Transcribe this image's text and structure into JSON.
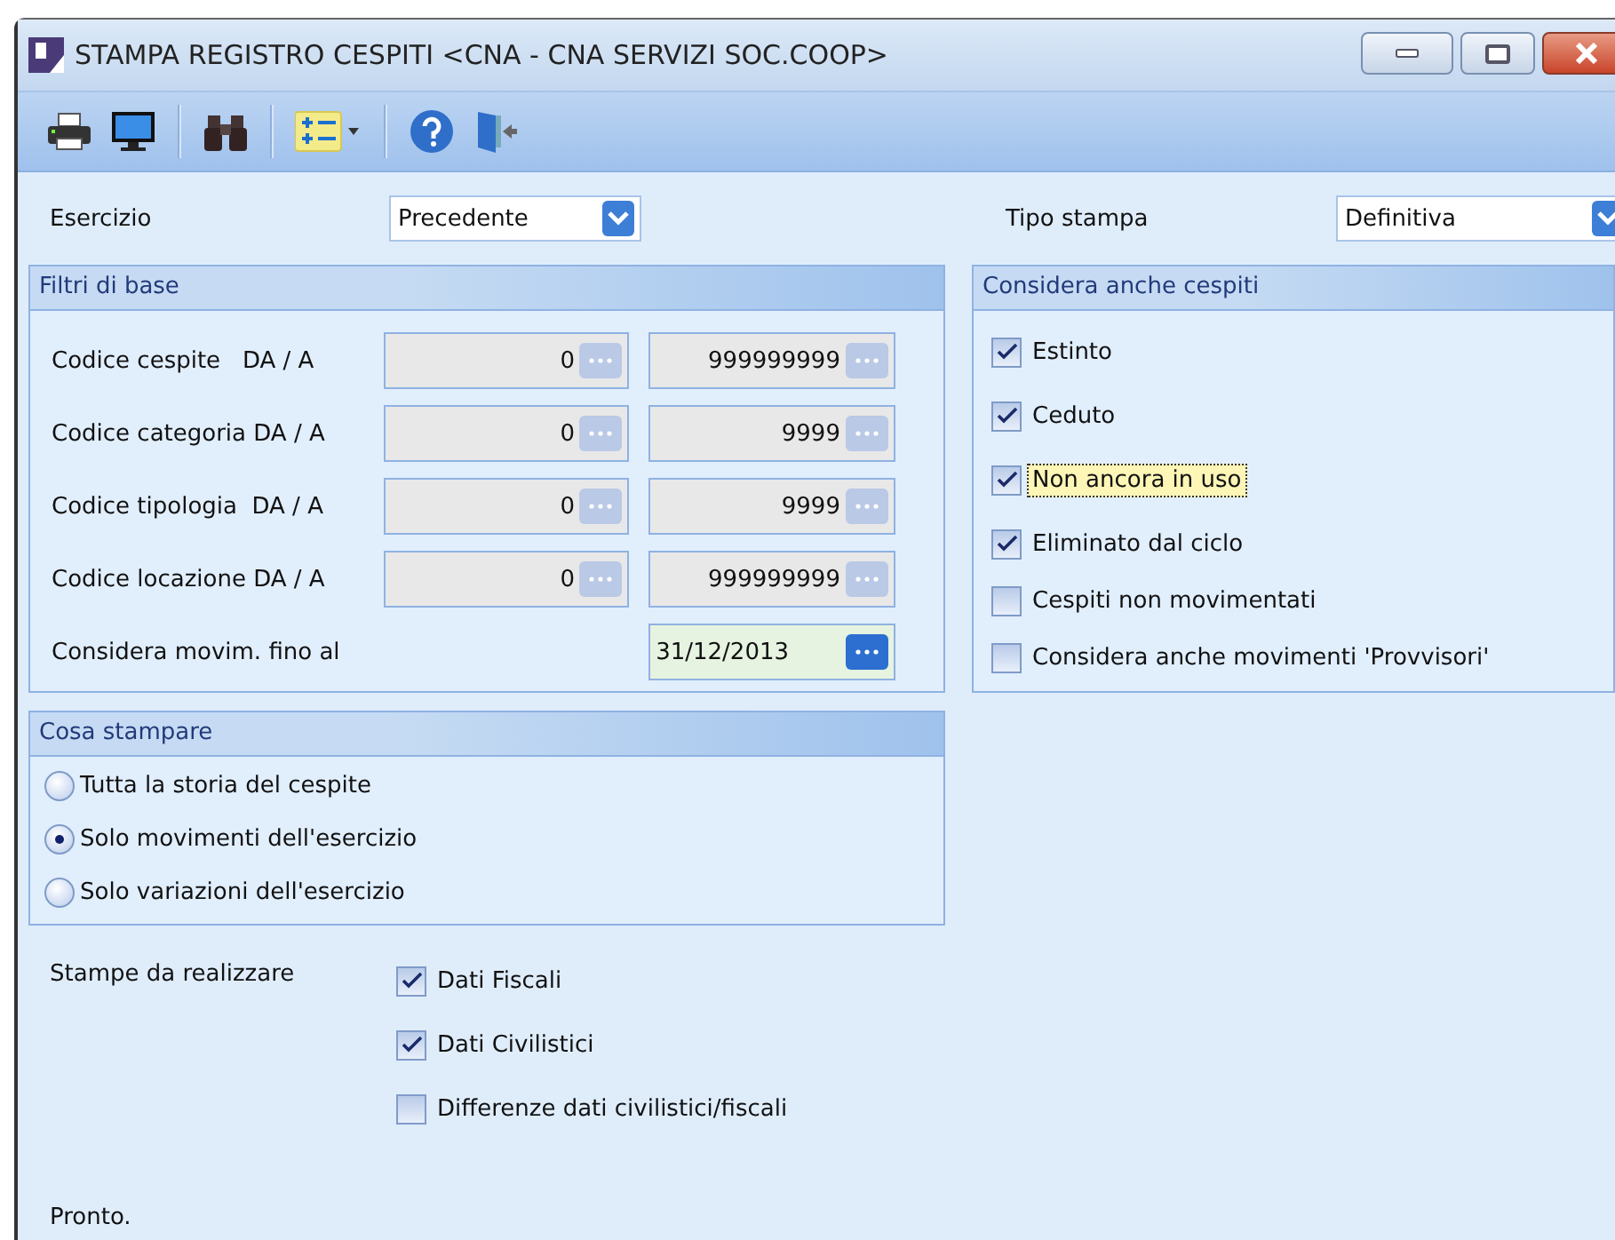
{
  "window": {
    "title": "STAMPA REGISTRO CESPITI <CNA - CNA SERVIZI SOC.COOP>"
  },
  "toolbar": {
    "buttons": [
      {
        "kind": "printer"
      },
      {
        "kind": "monitor"
      },
      {
        "kind": "separator"
      },
      {
        "kind": "binoculars"
      },
      {
        "kind": "separator"
      },
      {
        "kind": "list"
      },
      {
        "kind": "separator"
      },
      {
        "kind": "help"
      },
      {
        "kind": "exit"
      }
    ]
  },
  "esercizio": {
    "label": "Esercizio",
    "value": "Precedente"
  },
  "tipo_stampa": {
    "label": "Tipo stampa",
    "value": "Definitiva"
  },
  "filtri": {
    "title": "Filtri di base",
    "rows": [
      {
        "label": "Codice cespite   DA / A",
        "from": "0",
        "to": "999999999"
      },
      {
        "label": "Codice categoria DA / A",
        "from": "0",
        "to": "9999"
      },
      {
        "label": "Codice tipologia  DA / A",
        "from": "0",
        "to": "9999"
      },
      {
        "label": "Codice locazione DA / A",
        "from": "0",
        "to": "999999999"
      }
    ],
    "date": {
      "label": "Considera movim. fino al",
      "value": "31/12/2013"
    }
  },
  "considera": {
    "title": "Considera anche cespiti",
    "items": [
      {
        "label": "Estinto",
        "checked": true,
        "focused": false
      },
      {
        "label": "Ceduto",
        "checked": true,
        "focused": false
      },
      {
        "label": "Non ancora in uso",
        "checked": true,
        "focused": true
      },
      {
        "label": "Eliminato dal ciclo",
        "checked": true,
        "focused": false
      },
      {
        "label": "Cespiti non movimentati",
        "checked": false,
        "focused": false
      },
      {
        "label": "Considera anche movimenti 'Provvisori'",
        "checked": false,
        "focused": false
      }
    ]
  },
  "cosa_stampare": {
    "title": "Cosa stampare",
    "options": [
      {
        "label": "Tutta la storia del cespite",
        "selected": false
      },
      {
        "label": "Solo movimenti dell'esercizio",
        "selected": true
      },
      {
        "label": "Solo variazioni dell'esercizio",
        "selected": false
      }
    ]
  },
  "stampe": {
    "label": "Stampe da realizzare",
    "items": [
      {
        "label": "Dati Fiscali",
        "checked": true
      },
      {
        "label": "Dati Civilistici",
        "checked": true
      },
      {
        "label": "Differenze dati civilistici/fiscali",
        "checked": false
      }
    ]
  },
  "status_bar": "Pronto."
}
